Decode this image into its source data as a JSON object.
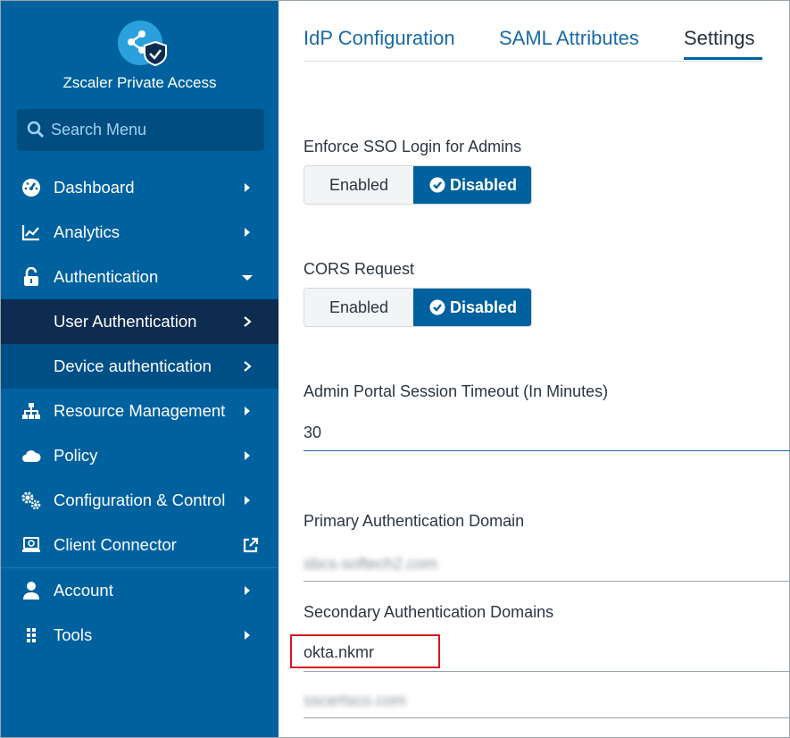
{
  "app": {
    "title": "Zscaler Private Access"
  },
  "search": {
    "placeholder": "Search Menu"
  },
  "sidebar": {
    "items": [
      {
        "label": "Dashboard",
        "icon": "dashboard-icon",
        "caret": "right"
      },
      {
        "label": "Analytics",
        "icon": "line-chart-icon",
        "caret": "right"
      },
      {
        "label": "Authentication",
        "icon": "unlock-icon",
        "caret": "down"
      },
      {
        "label": "User Authentication",
        "caret": "right",
        "active": true
      },
      {
        "label": "Device authentication",
        "caret": "right"
      },
      {
        "label": "Resource Management",
        "icon": "sitemap-icon",
        "caret": "right"
      },
      {
        "label": "Policy",
        "icon": "cloud-icon",
        "caret": "right"
      },
      {
        "label": "Configuration & Control",
        "icon": "cogs-icon",
        "caret": "right"
      },
      {
        "label": "Client Connector",
        "icon": "laptop-icon",
        "caret": "external-link"
      },
      {
        "label": "Account",
        "icon": "user-icon",
        "caret": "right"
      },
      {
        "label": "Tools",
        "icon": "grid-dots-icon",
        "caret": "right"
      }
    ]
  },
  "tabs": [
    {
      "label": "IdP Configuration",
      "selected": false
    },
    {
      "label": "SAML Attributes",
      "selected": false
    },
    {
      "label": "Settings",
      "selected": true
    }
  ],
  "settings": {
    "enforce_sso": {
      "label": "Enforce SSO Login for Admins",
      "enabled_label": "Enabled",
      "disabled_label": "Disabled",
      "selected": "Disabled"
    },
    "cors": {
      "label": "CORS Request",
      "enabled_label": "Enabled",
      "disabled_label": "Disabled",
      "selected": "Disabled"
    },
    "timeout": {
      "label": "Admin Portal Session Timeout (In Minutes)",
      "value": "30"
    },
    "primary_domain": {
      "label": "Primary Authentication Domain",
      "value": "sbcs-softech2.com"
    },
    "secondary_domains": {
      "label": "Secondary Authentication Domains",
      "values": [
        "okta.nkmr",
        "sscertsco.com"
      ]
    }
  },
  "colors": {
    "sidebar": "#00619f",
    "active_item": "#0d2c50",
    "accent": "#00619f",
    "highlight": "#d9161c"
  }
}
